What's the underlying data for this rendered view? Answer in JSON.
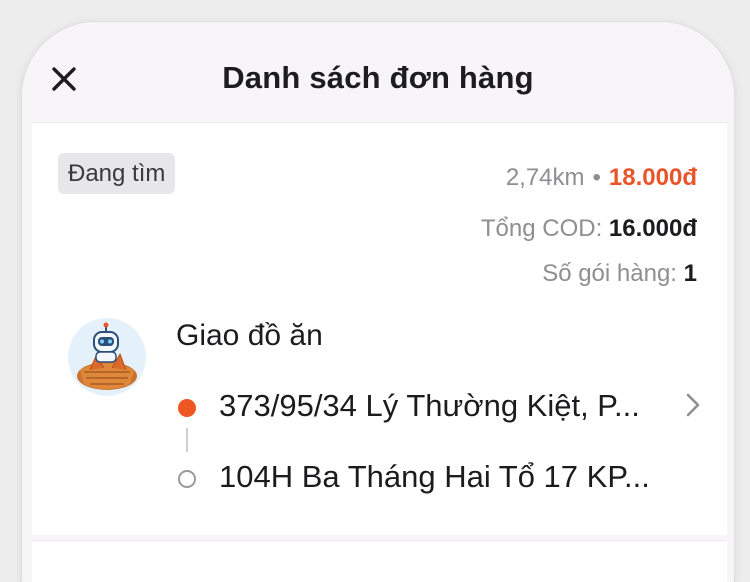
{
  "header": {
    "title": "Danh sách đơn hàng",
    "close_icon": "close-icon"
  },
  "order": {
    "status": "Đang tìm",
    "distance": "2,74km",
    "separator": "•",
    "fee": "18.000đ",
    "cod_label": "Tổng COD:",
    "cod_value": "16.000đ",
    "packages_label": "Số gói hàng:",
    "packages_value": "1",
    "service": "Giao đồ ăn",
    "pickup_address": "373/95/34 Lý Thường Kiệt, P...",
    "dropoff_address": "104H Ba Tháng Hai Tổ 17 KP...",
    "avatar_icon": "robot-food-avatar-icon",
    "chevron_icon": "chevron-right-icon"
  },
  "colors": {
    "accent": "#e8552a",
    "pickup_dot": "#ee5722",
    "background": "#f7f5f7",
    "card": "#ffffff"
  }
}
